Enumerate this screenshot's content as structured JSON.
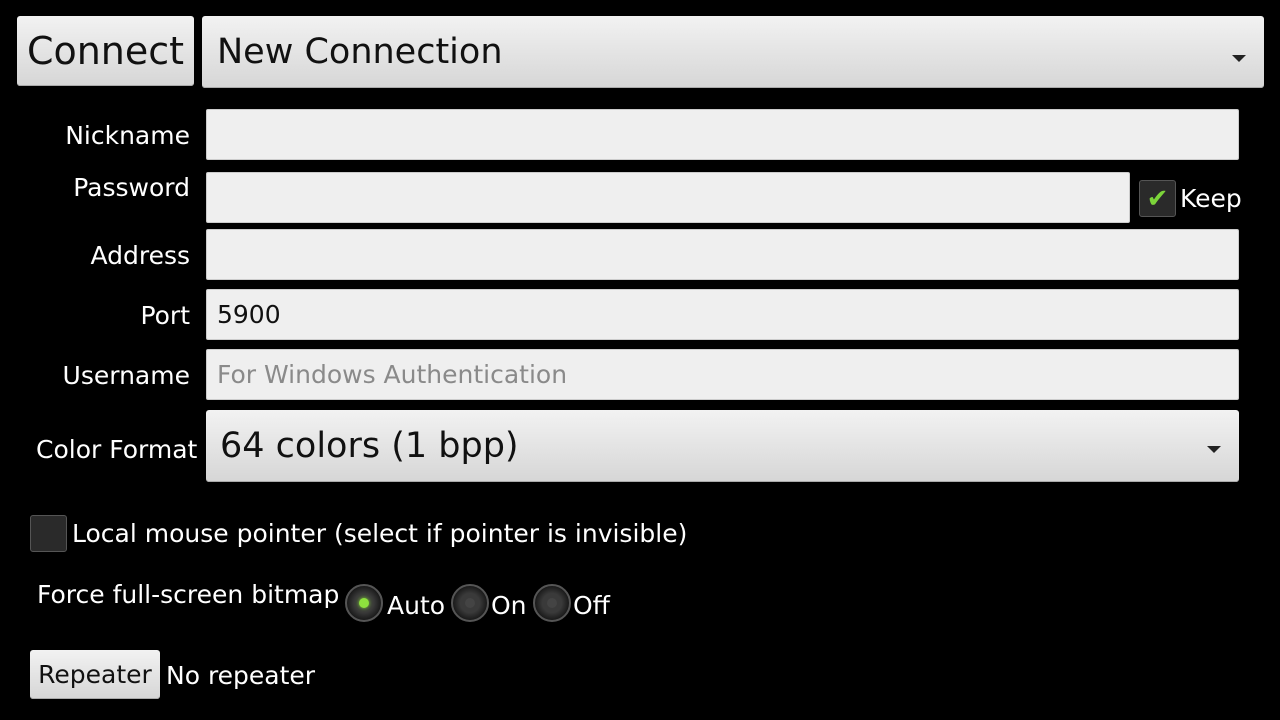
{
  "header": {
    "connect_label": "Connect",
    "connection_selected": "New Connection"
  },
  "form": {
    "nickname": {
      "label": "Nickname",
      "value": "",
      "placeholder": ""
    },
    "password": {
      "label": "Password",
      "value": "",
      "placeholder": "",
      "keep_label": "Keep",
      "keep_checked": true
    },
    "address": {
      "label": "Address",
      "value": "",
      "placeholder": ""
    },
    "port": {
      "label": "Port",
      "value": "5900"
    },
    "username": {
      "label": "Username",
      "value": "",
      "placeholder": "For Windows Authentication"
    },
    "color_format": {
      "label": "Color Format",
      "selected": "64 colors (1 bpp)"
    }
  },
  "options": {
    "local_mouse": {
      "label": "Local mouse pointer (select if pointer is invisible)",
      "checked": false
    },
    "force_fullscreen": {
      "label": "Force full-screen bitmap",
      "choices": [
        {
          "label": "Auto",
          "checked": true
        },
        {
          "label": "On",
          "checked": false
        },
        {
          "label": "Off",
          "checked": false
        }
      ]
    }
  },
  "repeater": {
    "button_label": "Repeater",
    "status": "No repeater"
  },
  "colors": {
    "background": "#000000",
    "accent_green": "#8ee03e"
  }
}
